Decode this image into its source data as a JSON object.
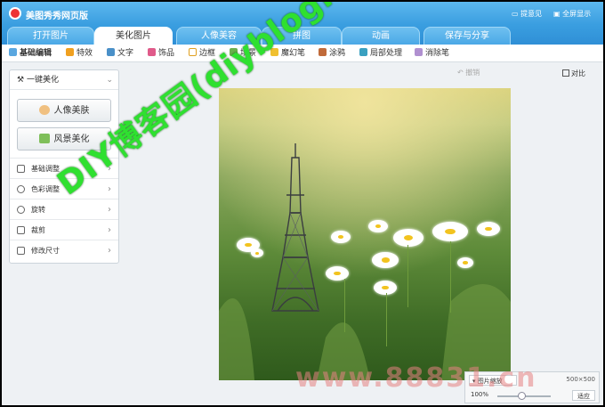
{
  "window": {
    "title": "美图秀秀网页版",
    "feedback": "提意见",
    "fullscreen": "全屏显示"
  },
  "tabs": [
    {
      "label": "打开图片"
    },
    {
      "label": "美化图片"
    },
    {
      "label": "人像美容"
    },
    {
      "label": "拼图"
    },
    {
      "label": "动画"
    },
    {
      "label": "保存与分享"
    }
  ],
  "active_tab": "美化图片",
  "toolbar": {
    "items": [
      {
        "label": "基础编辑"
      },
      {
        "label": "特效"
      },
      {
        "label": "文字"
      },
      {
        "label": "饰品"
      },
      {
        "label": "边框"
      },
      {
        "label": "场景"
      },
      {
        "label": "魔幻笔"
      },
      {
        "label": "涂鸦"
      },
      {
        "label": "局部处理"
      },
      {
        "label": "消除笔"
      }
    ],
    "undo": "撤销",
    "compare": "对比"
  },
  "left_panel": {
    "header": "一键美化",
    "buttons": [
      {
        "label": "人像美肤"
      },
      {
        "label": "风景美化"
      }
    ],
    "menu": [
      {
        "label": "基础调整"
      },
      {
        "label": "色彩调整"
      },
      {
        "label": "旋转"
      },
      {
        "label": "裁剪"
      },
      {
        "label": "修改尺寸"
      }
    ]
  },
  "status": {
    "scale_mode": "图片缩放",
    "image_size": "500×500",
    "zoom": "100%",
    "zoom_level": 0.45,
    "fit": "适应"
  },
  "overlays": {
    "watermark": "DIY博客园(diybloghome.com)",
    "site": "www.88831.cn"
  },
  "colors": {
    "title_bar": "#3a9ee0",
    "watermark": "#2fe030"
  }
}
